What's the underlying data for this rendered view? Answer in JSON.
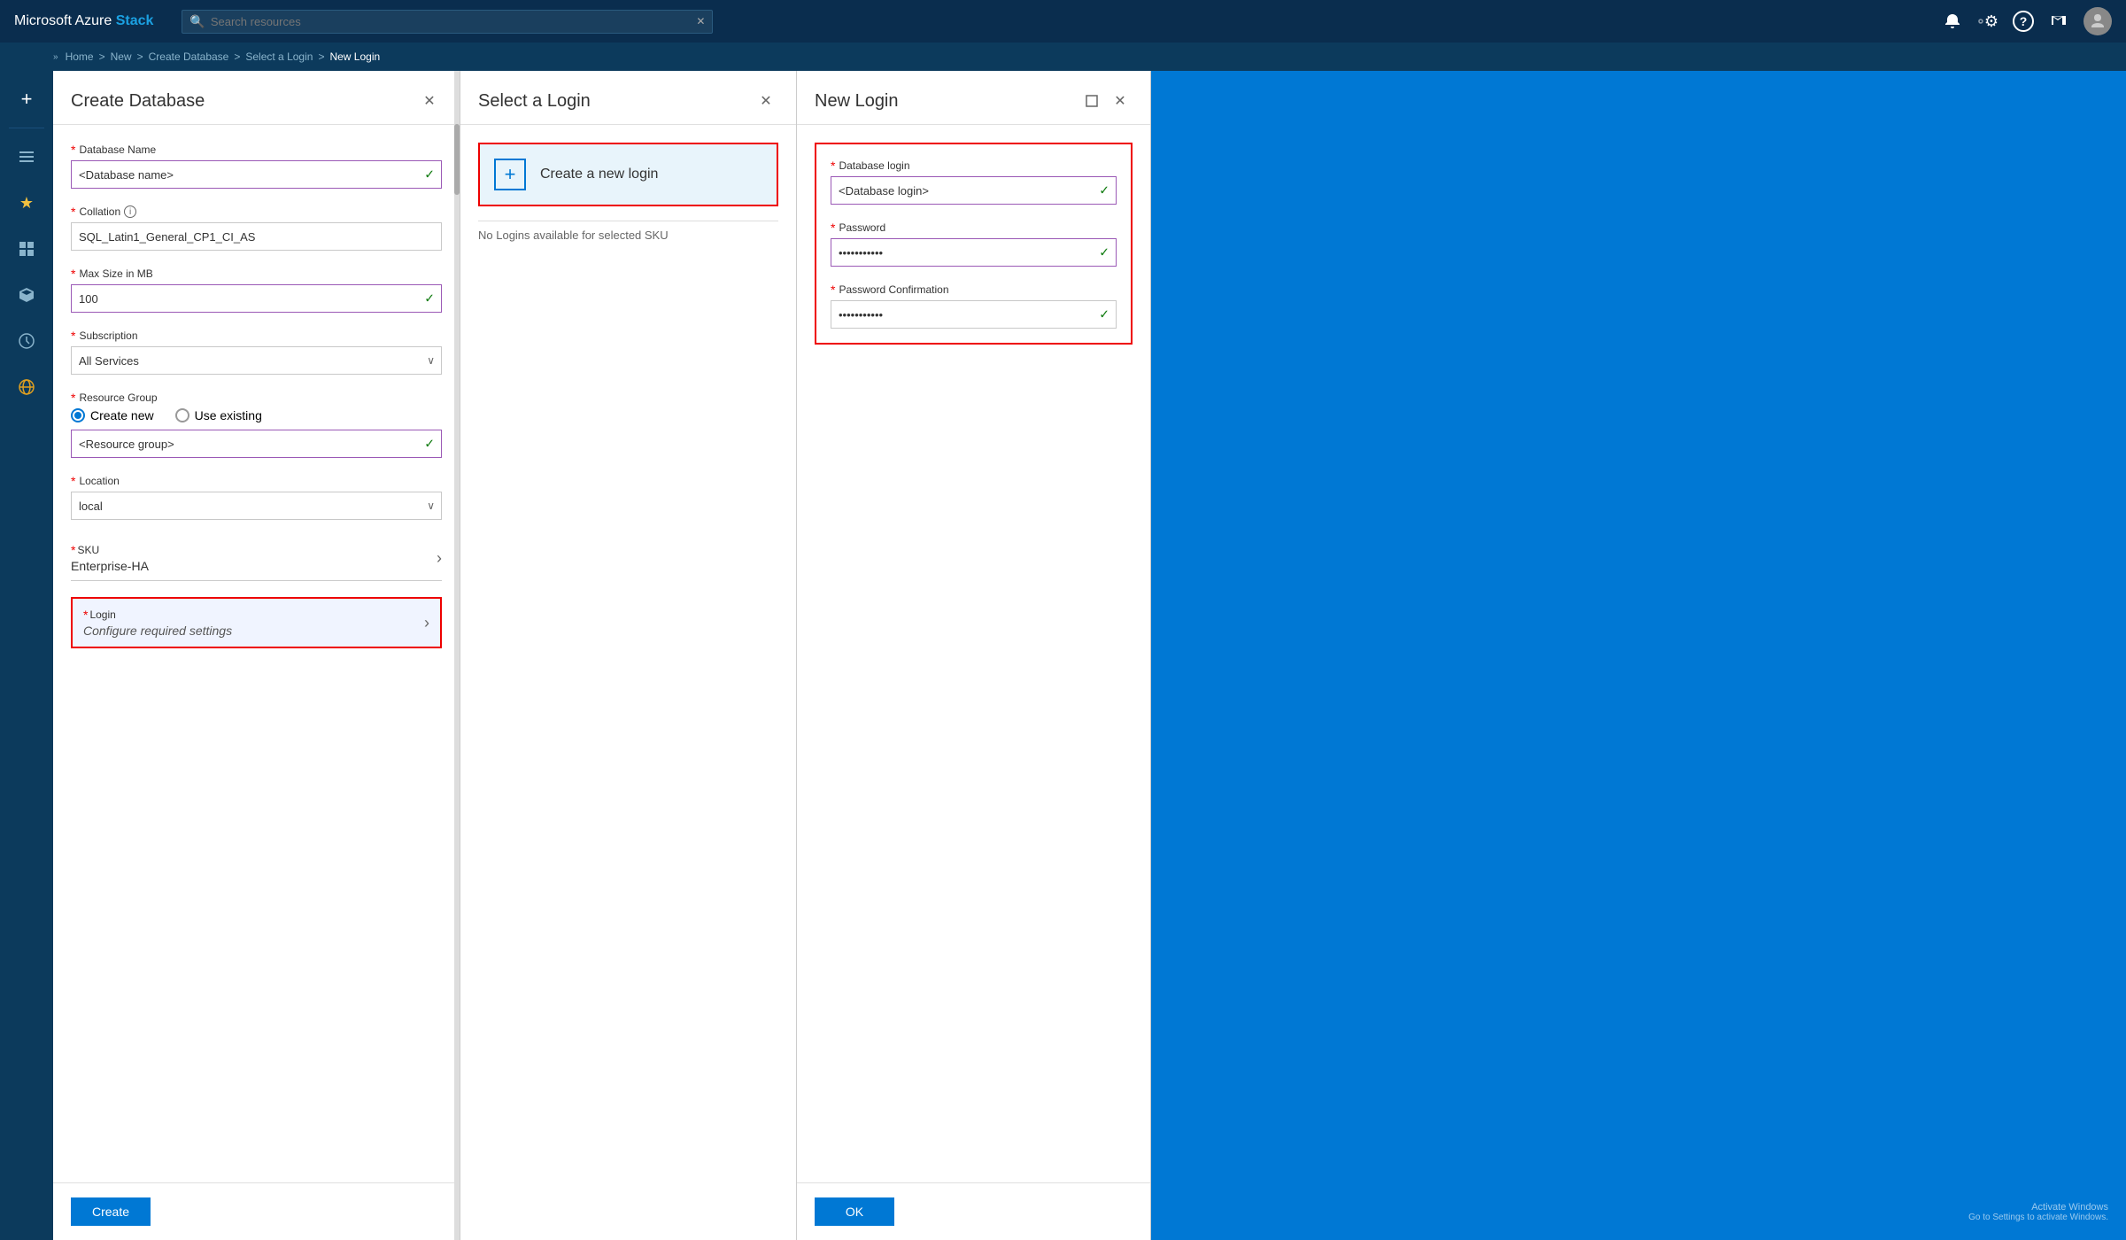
{
  "app": {
    "title_prefix": "Microsoft Azure",
    "title_suffix": "Stack"
  },
  "topbar": {
    "search_placeholder": "Search resources",
    "icons": [
      "bell",
      "gear",
      "question",
      "user-arrow",
      "avatar"
    ]
  },
  "breadcrumb": {
    "items": [
      "Home",
      "New",
      "Create Database",
      "Select a Login",
      "New Login"
    ]
  },
  "sidebar": {
    "buttons": [
      "+",
      "list",
      "star",
      "grid",
      "cube",
      "clock",
      "globe"
    ]
  },
  "panel1": {
    "title": "Create Database",
    "fields": {
      "database_name_label": "Database Name",
      "database_name_value": "<Database name>",
      "collation_label": "Collation",
      "collation_value": "SQL_Latin1_General_CP1_CI_AS",
      "max_size_label": "Max Size in MB",
      "max_size_value": "100",
      "subscription_label": "Subscription",
      "subscription_value": "All Services",
      "resource_group_label": "Resource Group",
      "resource_group_create_new": "Create new",
      "resource_group_use_existing": "Use existing",
      "resource_group_value": "<Resource group>",
      "location_label": "Location",
      "location_value": "local",
      "sku_label": "SKU",
      "sku_value": "Enterprise-HA",
      "login_label": "Login",
      "login_value": "Configure required settings"
    },
    "footer": {
      "create_btn": "Create"
    }
  },
  "panel2": {
    "title": "Select a Login",
    "create_new_login": "Create a new login",
    "no_logins_text": "No Logins available for selected SKU"
  },
  "panel3": {
    "title": "New Login",
    "fields": {
      "db_login_label": "Database login",
      "db_login_value": "<Database login>",
      "password_label": "Password",
      "password_value": "••••••••••",
      "password_confirm_label": "Password Confirmation",
      "password_confirm_value": "••••••••••"
    },
    "footer": {
      "ok_btn": "OK"
    }
  },
  "icons": {
    "search": "🔍",
    "bell": "🔔",
    "gear": "⚙",
    "question": "?",
    "user_arrow": "↗",
    "close": "✕",
    "check": "✓",
    "chevron_down": "∨",
    "chevron_right": "›",
    "maximize": "⬜",
    "plus": "+"
  }
}
